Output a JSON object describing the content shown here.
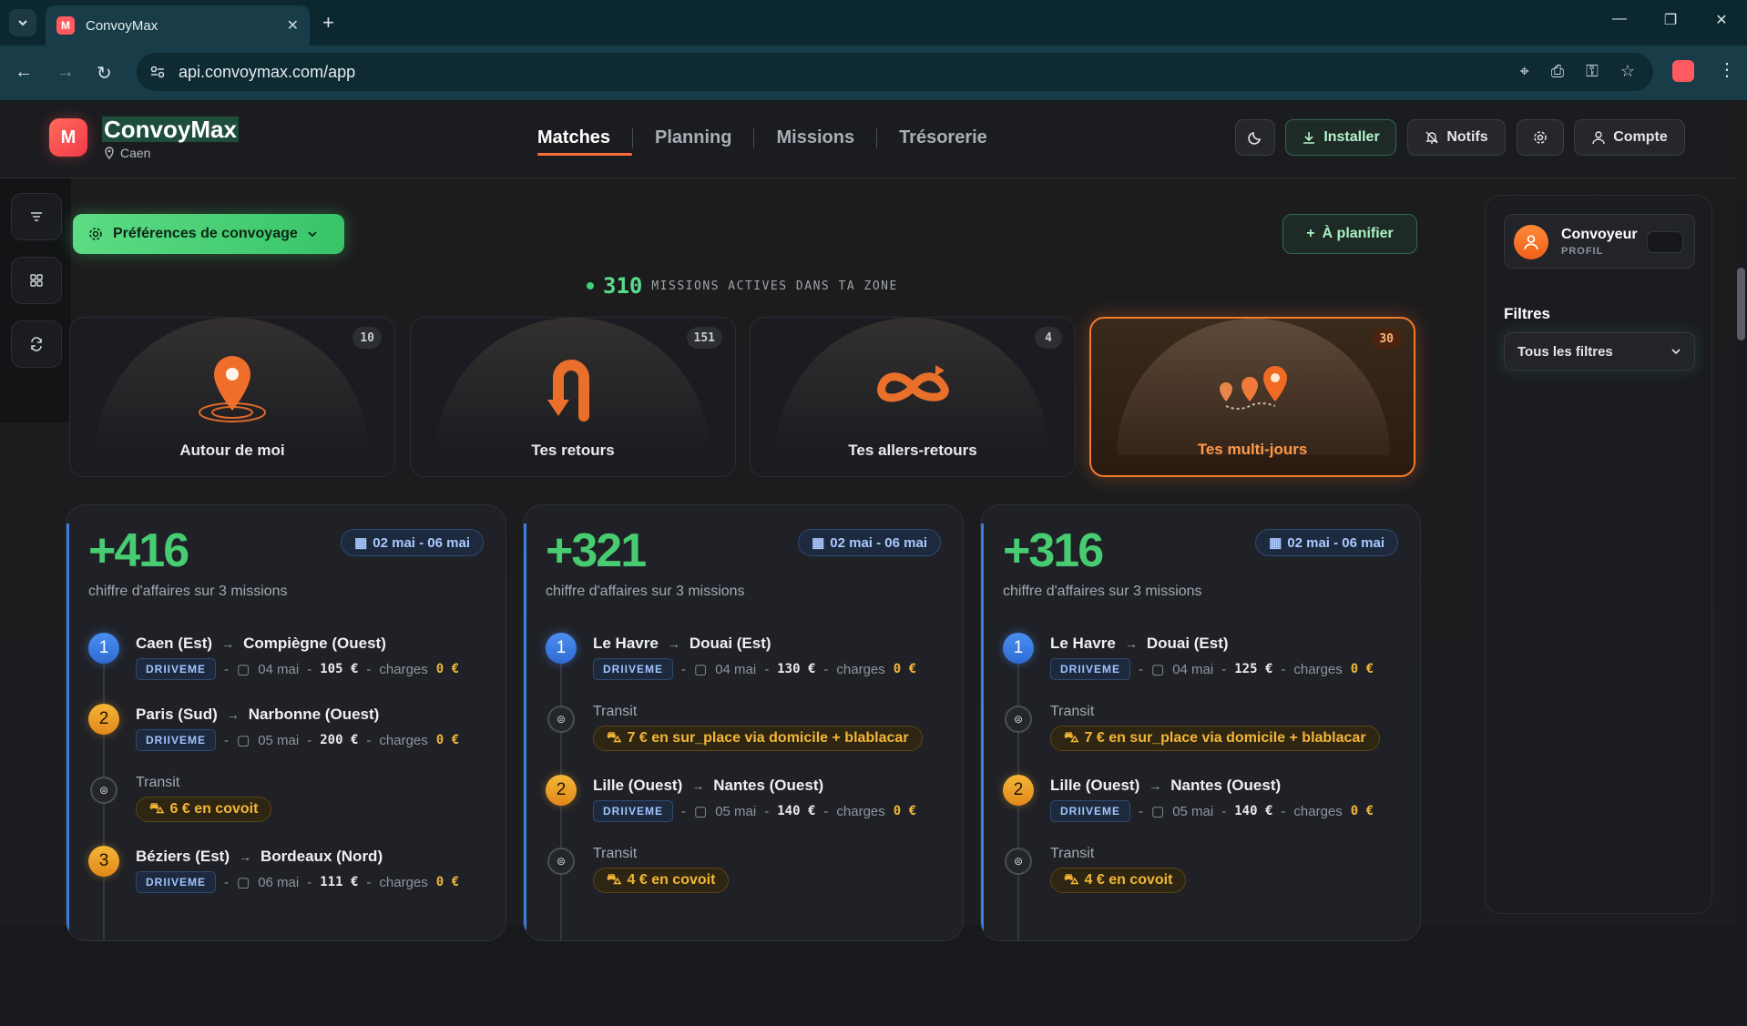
{
  "browser": {
    "tab_title": "ConvoyMax",
    "url": "api.convoymax.com/app",
    "favicon_letter": "M"
  },
  "header": {
    "brand": "ConvoyMax",
    "city": "Caen",
    "logo_letter": "M",
    "nav": [
      "Matches",
      "Planning",
      "Missions",
      "Trésorerie"
    ],
    "install_label": "Installer",
    "notifs_label": "Notifs",
    "account_label": "Compte"
  },
  "toolbar": {
    "preferences_label": "Préférences de convoyage",
    "plan_label": "À planifier",
    "active_count": "310",
    "active_label": "MISSIONS ACTIVES DANS TA ZONE"
  },
  "categories": [
    {
      "label": "Autour de moi",
      "count": "10"
    },
    {
      "label": "Tes retours",
      "count": "151"
    },
    {
      "label": "Tes allers-retours",
      "count": "4"
    },
    {
      "label": "Tes multi-jours",
      "count": "30"
    }
  ],
  "cards": [
    {
      "amount": "+416",
      "subtitle": "chiffre d'affaires sur 3 missions",
      "date_range": "02 mai - 06 mai",
      "steps": [
        {
          "kind": "mission",
          "n": "1",
          "color": "blue",
          "from": "Caen (Est)",
          "to": "Compiègne (Ouest)",
          "tag": "DRIIVEME",
          "date": "04 mai",
          "price": "105 €",
          "charges_label": "charges",
          "charges": "0 €"
        },
        {
          "kind": "mission",
          "n": "2",
          "color": "orange",
          "from": "Paris (Sud)",
          "to": "Narbonne (Ouest)",
          "tag": "DRIIVEME",
          "date": "05 mai",
          "price": "200 €",
          "charges_label": "charges",
          "charges": "0 €"
        },
        {
          "kind": "transit",
          "label": "Transit",
          "pill": "6 € en covoit"
        },
        {
          "kind": "mission",
          "n": "3",
          "color": "orange",
          "from": "Béziers (Est)",
          "to": "Bordeaux (Nord)",
          "tag": "DRIIVEME",
          "date": "06 mai",
          "price": "111 €",
          "charges_label": "charges",
          "charges": "0 €"
        }
      ]
    },
    {
      "amount": "+321",
      "subtitle": "chiffre d'affaires sur 3 missions",
      "date_range": "02 mai - 06 mai",
      "steps": [
        {
          "kind": "mission",
          "n": "1",
          "color": "blue",
          "from": "Le Havre",
          "to": "Douai (Est)",
          "tag": "DRIIVEME",
          "date": "04 mai",
          "price": "130 €",
          "charges_label": "charges",
          "charges": "0 €"
        },
        {
          "kind": "transit",
          "label": "Transit",
          "pill": "7 € en sur_place via domicile + blablacar"
        },
        {
          "kind": "mission",
          "n": "2",
          "color": "orange",
          "from": "Lille (Ouest)",
          "to": "Nantes (Ouest)",
          "tag": "DRIIVEME",
          "date": "05 mai",
          "price": "140 €",
          "charges_label": "charges",
          "charges": "0 €"
        },
        {
          "kind": "transit",
          "label": "Transit",
          "pill": "4 € en covoit"
        }
      ]
    },
    {
      "amount": "+316",
      "subtitle": "chiffre d'affaires sur 3 missions",
      "date_range": "02 mai - 06 mai",
      "steps": [
        {
          "kind": "mission",
          "n": "1",
          "color": "blue",
          "from": "Le Havre",
          "to": "Douai (Est)",
          "tag": "DRIIVEME",
          "date": "04 mai",
          "price": "125 €",
          "charges_label": "charges",
          "charges": "0 €"
        },
        {
          "kind": "transit",
          "label": "Transit",
          "pill": "7 € en sur_place via domicile + blablacar"
        },
        {
          "kind": "mission",
          "n": "2",
          "color": "orange",
          "from": "Lille (Ouest)",
          "to": "Nantes (Ouest)",
          "tag": "DRIIVEME",
          "date": "05 mai",
          "price": "140 €",
          "charges_label": "charges",
          "charges": "0 €"
        },
        {
          "kind": "transit",
          "label": "Transit",
          "pill": "4 € en covoit"
        }
      ]
    }
  ],
  "sidebar": {
    "profile_name": "Convoyeur",
    "profile_role": "PROFIL",
    "filters_title": "Filtres",
    "filters_value": "Tous les filtres"
  },
  "colors": {
    "accent_green": "#47cc72",
    "accent_orange": "#f07a2e",
    "accent_blue": "#3b7ddb"
  }
}
